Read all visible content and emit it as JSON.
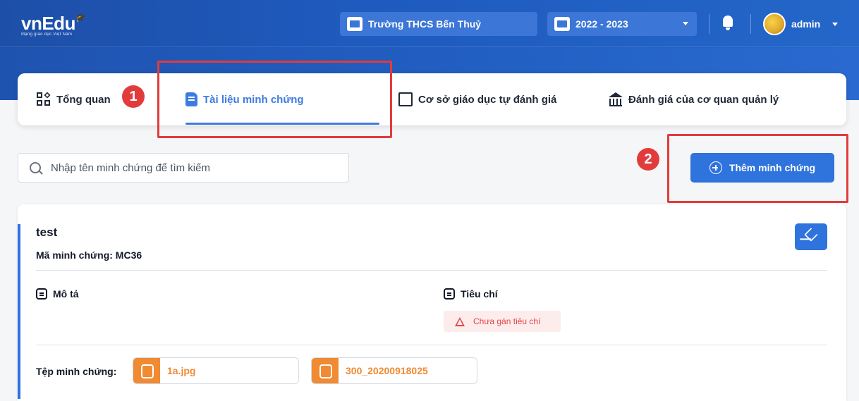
{
  "header": {
    "logo_text": "vnEdu",
    "logo_tagline": "Mạng giáo dục Việt Nam",
    "school": "Trường THCS Bến Thuỷ",
    "school_year": "2022 - 2023",
    "user_name": "admin"
  },
  "tabs": [
    {
      "label": "Tổng quan",
      "icon": "grid-icon"
    },
    {
      "label": "Tài liệu minh chứng",
      "icon": "document-icon",
      "active": true
    },
    {
      "label": "Cơ sở giáo dục tự đánh giá",
      "icon": "school-icon"
    },
    {
      "label": "Đánh giá của cơ quan quản lý",
      "icon": "bank-icon"
    }
  ],
  "annotations": {
    "badge1": "1",
    "badge2": "2"
  },
  "search": {
    "placeholder": "Nhập tên minh chứng để tìm kiếm"
  },
  "add_button": {
    "label": "Thêm minh chứng"
  },
  "evidence": {
    "title": "test",
    "code": "Mã minh chứng: MC36",
    "description_label": "Mô tả",
    "criteria_label": "Tiêu chí",
    "criteria_warning": "Chưa gán tiêu chí",
    "files_label": "Tệp minh chứng:",
    "files": [
      "1a.jpg",
      "300_20200918025"
    ]
  },
  "colors": {
    "header": "#1f5bbf",
    "primary": "#2f73dd",
    "annotation": "#e23b3b",
    "file_accent": "#f08a33",
    "warning": "#e0464a"
  }
}
